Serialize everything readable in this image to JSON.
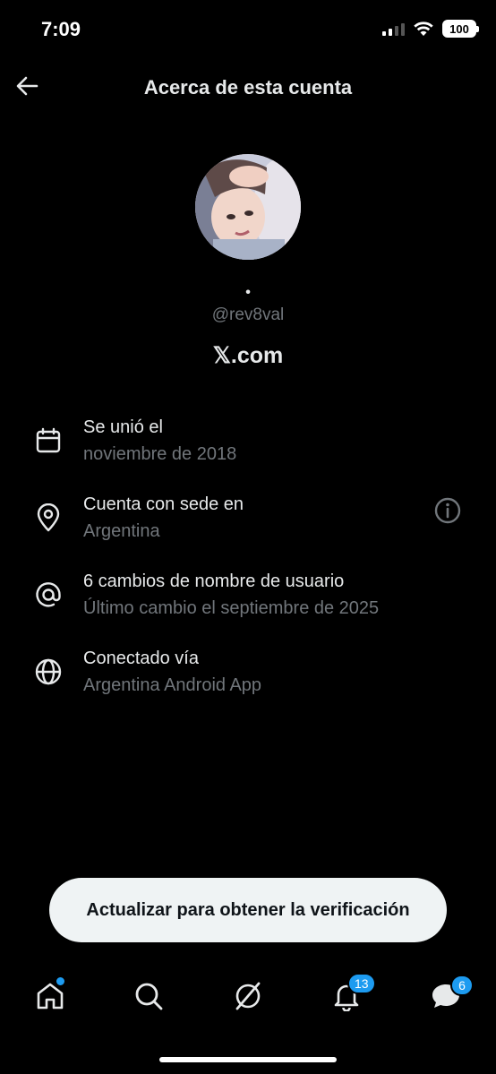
{
  "status_bar": {
    "time": "7:09",
    "battery": "100"
  },
  "header": {
    "title": "Acerca de esta cuenta"
  },
  "profile": {
    "display_name": "•",
    "handle": "@rev8val",
    "domain": "𝕏.com"
  },
  "info": [
    {
      "icon": "calendar-icon",
      "title": "Se unió el",
      "subtitle": "noviembre de 2018"
    },
    {
      "icon": "location-pin-icon",
      "title": "Cuenta con sede en",
      "subtitle": "Argentina"
    },
    {
      "icon": "at-icon",
      "title": "6 cambios de nombre de usuario",
      "subtitle": "Último cambio el septiembre de 2025"
    },
    {
      "icon": "globe-icon",
      "title": "Conectado vía",
      "subtitle": "Argentina Android App"
    }
  ],
  "verify_button": {
    "label": "Actualizar para obtener la verificación"
  },
  "tab_bar": {
    "notifications_count": "13",
    "messages_count": "6"
  },
  "colors": {
    "background": "#000000",
    "accent": "#1d9bf0",
    "secondary_text": "#71767b"
  }
}
